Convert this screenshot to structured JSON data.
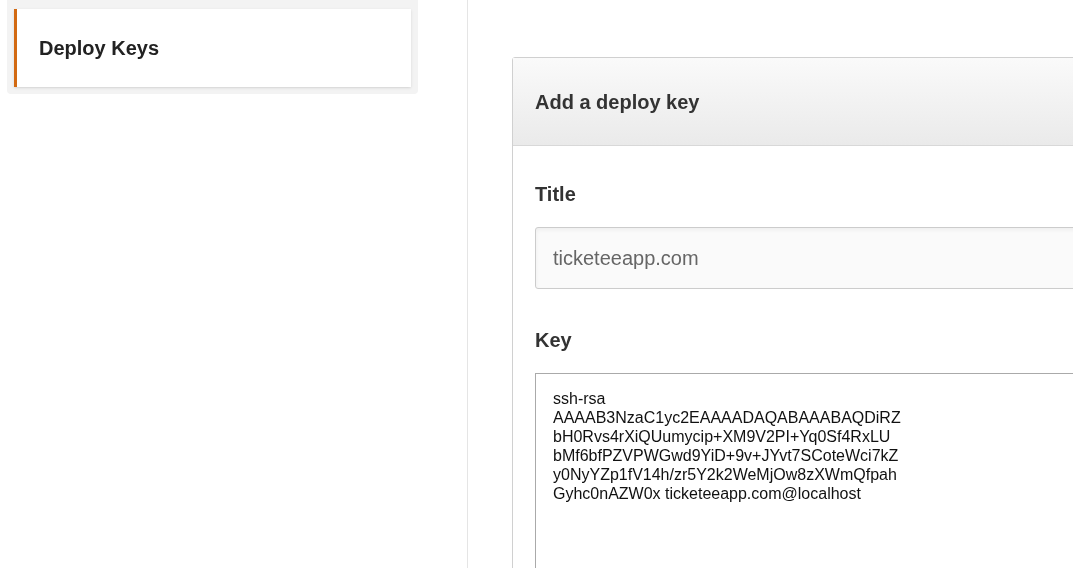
{
  "sidebar": {
    "items": [
      {
        "label": "Deploy Keys",
        "selected": true
      }
    ]
  },
  "panel": {
    "title": "Add a deploy key",
    "fields": [
      {
        "kind": "input",
        "label": "Title",
        "value": "ticketeeapp.com"
      },
      {
        "kind": "textarea",
        "label": "Key",
        "value": "ssh-rsa\nAAAAB3NzaC1yc2EAAAADAQABAAABAQDiRZ\nbH0Rvs4rXiQUumycip+XM9V2PI+Yq0Sf4RxLU\nbMf6bfPZVPWGwd9YiD+9v+JYvt7SCoteWci7kZ\ny0NyYZp1fV14h/zr5Y2k2WeMjOw8zXWmQfpah\nGyhc0nAZW0x ticketeeapp.com@localhost"
      }
    ]
  }
}
